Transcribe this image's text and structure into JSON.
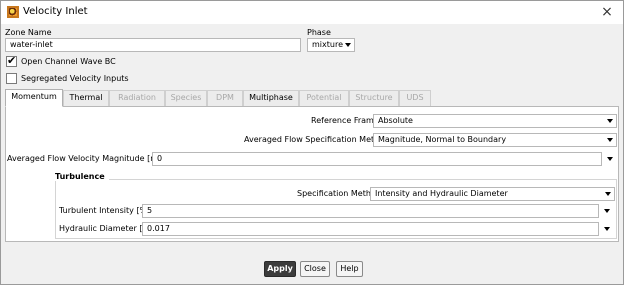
{
  "window": {
    "title": "Velocity Inlet",
    "close_label": "×"
  },
  "zone": {
    "label": "Zone Name",
    "value": "water-inlet"
  },
  "phase": {
    "label": "Phase",
    "value": "mixture"
  },
  "options": {
    "open_channel": {
      "label": "Open Channel Wave BC",
      "checked": true
    },
    "segregated": {
      "label": "Segregated Velocity Inputs",
      "checked": false
    }
  },
  "tabs": [
    {
      "label": "Momentum",
      "state": "active"
    },
    {
      "label": "Thermal",
      "state": "enabled"
    },
    {
      "label": "Radiation",
      "state": "disabled"
    },
    {
      "label": "Species",
      "state": "disabled"
    },
    {
      "label": "DPM",
      "state": "disabled"
    },
    {
      "label": "Multiphase",
      "state": "enabled"
    },
    {
      "label": "Potential",
      "state": "disabled"
    },
    {
      "label": "Structure",
      "state": "disabled"
    },
    {
      "label": "UDS",
      "state": "disabled"
    }
  ],
  "momentum": {
    "reference_frame": {
      "label": "Reference Frame",
      "value": "Absolute"
    },
    "spec_method": {
      "label": "Averaged Flow Specification Method",
      "value": "Magnitude, Normal to Boundary"
    },
    "velocity_magnitude": {
      "label": "Averaged Flow Velocity Magnitude [m/s]",
      "value": "0"
    },
    "turbulence": {
      "title": "Turbulence",
      "spec_method": {
        "label": "Specification Method",
        "value": "Intensity and Hydraulic Diameter"
      },
      "intensity": {
        "label": "Turbulent Intensity [%]",
        "value": "5"
      },
      "hydraulic_diameter": {
        "label": "Hydraulic Diameter [m]",
        "value": "0.017"
      }
    }
  },
  "buttons": {
    "apply": "Apply",
    "close": "Close",
    "help": "Help"
  }
}
